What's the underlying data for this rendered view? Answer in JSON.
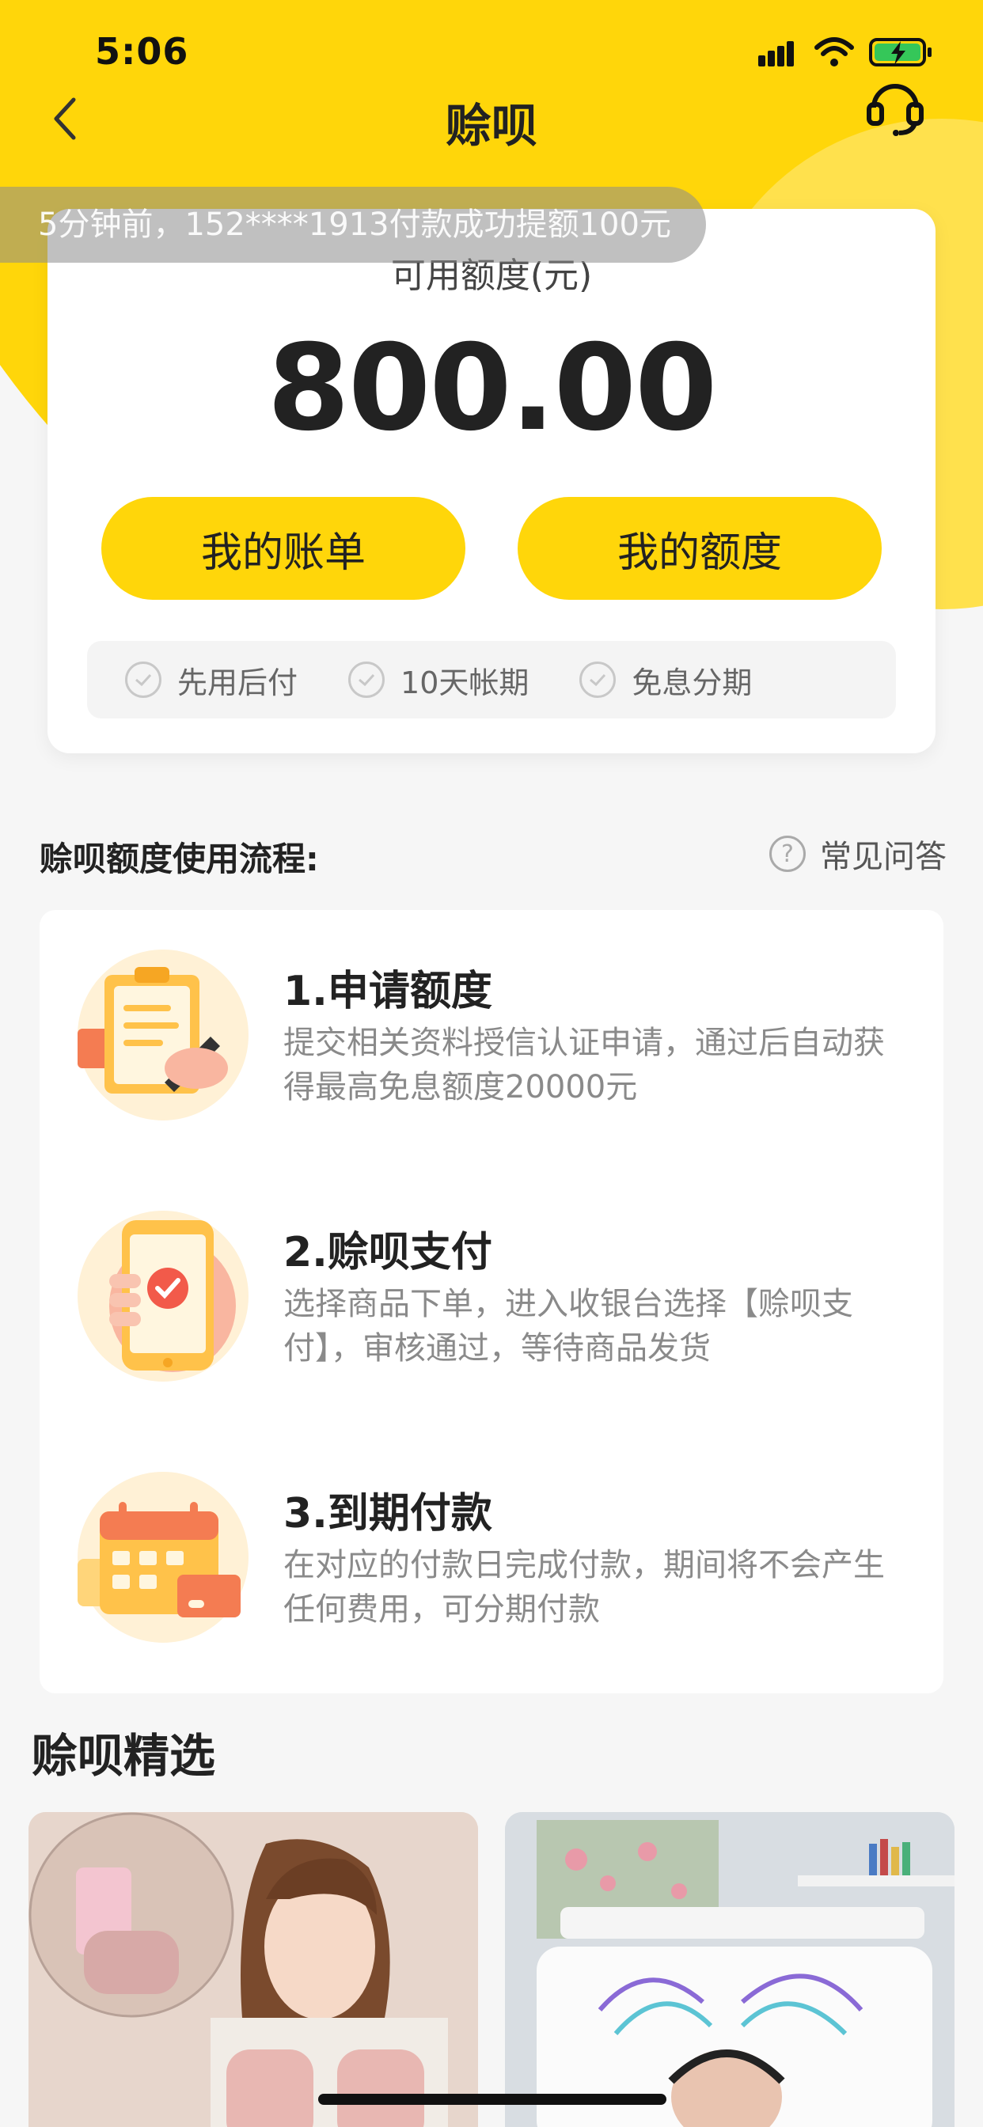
{
  "status_bar": {
    "time": "5:06"
  },
  "nav": {
    "title": "赊呗"
  },
  "toast": {
    "text": "5分钟前，152****1913付款成功提额100元"
  },
  "credit": {
    "label": "可用额度(元)",
    "amount": "800.00",
    "bill_button": "我的账单",
    "quota_button": "我的额度",
    "features": [
      "先用后付",
      "10天帐期",
      "免息分期"
    ]
  },
  "process": {
    "title": "赊呗额度使用流程:",
    "faq_label": "常见问答",
    "steps": [
      {
        "title": "1.申请额度",
        "desc": "提交相关资料授信认证申请，通过后自动获得最高免息额度20000元",
        "icon": "clipboard-pen-icon"
      },
      {
        "title": "2.赊呗支付",
        "desc": "选择商品下单，进入收银台选择【赊呗支付】，审核通过，等待商品发货",
        "icon": "phone-check-icon"
      },
      {
        "title": "3.到期付款",
        "desc": "在对应的付款日完成付款，期间将不会产生任何费用，可分期付款",
        "icon": "calendar-card-icon"
      }
    ]
  },
  "picks": {
    "title": "赊呗精选"
  },
  "colors": {
    "brand_yellow": "#FFD60A",
    "battery_green": "#35C759"
  }
}
